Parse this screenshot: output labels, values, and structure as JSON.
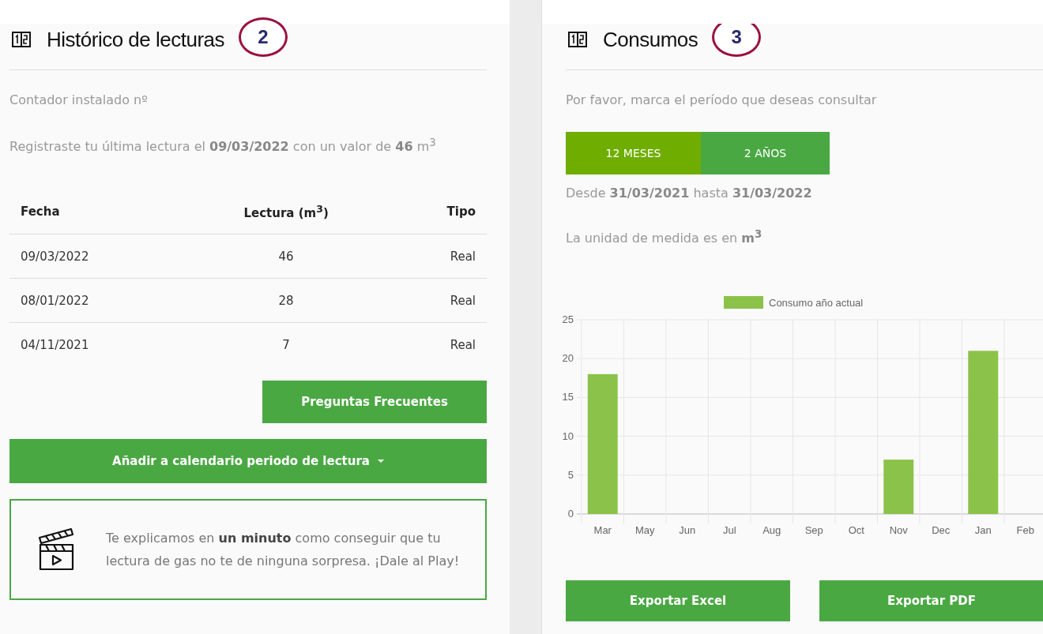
{
  "history": {
    "title": "Histórico de lecturas",
    "badge": "2",
    "meter_label": "Contador instalado nº",
    "last_reading": "Registraste tu última lectura el **09/03/2022** con un valor de **46** m$^{3}$",
    "table": {
      "columns": [
        "Fecha",
        "Lectura (m$^{3}$)",
        "Tipo"
      ],
      "rows": [
        [
          "09/03/2022",
          "46",
          "Real"
        ],
        [
          "08/01/2022",
          "28",
          "Real"
        ],
        [
          "04/11/2021",
          "7",
          "Real"
        ]
      ]
    },
    "faq_button": "Preguntas Frecuentes",
    "calendar_button": "Añadir a calendario periodo de lectura",
    "video_text": "Te explicamos en **un minuto** como conseguir que tu lectura de gas no te de ninguna sorpresa. ¡Dale al Play!"
  },
  "consumption": {
    "title": "Consumos",
    "badge": "3",
    "prompt": "Por favor, marca el período que deseas consultar",
    "periods": [
      {
        "label": "12 MESES",
        "selected": true
      },
      {
        "label": "2 AÑOS",
        "selected": false
      }
    ],
    "range": "Desde **31/03/2021** hasta **31/03/2022**",
    "unit": "La unidad de medida es en **m$^{3}$**",
    "chart_data": {
      "type": "bar",
      "categories": [
        "Mar",
        "May",
        "Jun",
        "Jul",
        "Aug",
        "Sep",
        "Oct",
        "Nov",
        "Dec",
        "Jan",
        "Feb"
      ],
      "series": [
        {
          "name": "Consumo año actual",
          "color": "#8bc34a",
          "values": [
            18,
            0,
            0,
            0,
            0,
            0,
            0,
            7,
            0,
            21,
            0
          ]
        }
      ],
      "grid": true,
      "ylim": [
        0,
        25
      ],
      "yticks": [
        0,
        5,
        10,
        15,
        20,
        25
      ]
    },
    "export_buttons": [
      "Exportar Excel",
      "Exportar PDF"
    ]
  }
}
